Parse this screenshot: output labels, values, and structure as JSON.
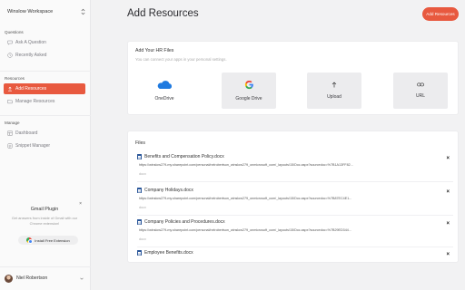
{
  "sidebar": {
    "workspace": "Winslow Workspace",
    "sections": {
      "questions": "Questions",
      "resources": "Resources",
      "manage": "Manage"
    },
    "items": {
      "ask": "Ask A Question",
      "recent": "Recently Asked",
      "add_resources": "Add Resources",
      "manage_resources": "Manage Resources",
      "dashboard": "Dashboard",
      "snippet": "Snippet Manager"
    },
    "plugin": {
      "title": "Gmail Plugin",
      "desc": "Get answers from inside of Gmail with our Chrome extension!",
      "button": "Install Free Extension",
      "close": "×"
    },
    "user": "Niel Robertson"
  },
  "header": {
    "title": "Add Resources",
    "button": "Add Resources"
  },
  "hr_files": {
    "title": "Add Your HR Files",
    "subtitle": "You can connect your apps in your personal settings.",
    "tiles": [
      {
        "label": "OneDrive",
        "icon": "onedrive-icon"
      },
      {
        "label": "Google Drive",
        "icon": "google-drive-icon"
      },
      {
        "label": "Upload",
        "icon": "upload-arrow-icon"
      },
      {
        "label": "URL",
        "icon": "link-icon"
      }
    ]
  },
  "files": {
    "title": "Files",
    "items": [
      {
        "name": "Benefits and Compensation Policy.docx",
        "url": "https://winslow279-my.sharepoint.com/personal/nelrobertson_winslow279_onmicrosoft_com/_layouts/15/Doc.aspx?sourcedoc=%7B1A13FF82...",
        "type": "docx"
      },
      {
        "name": "Company Holidays.docx",
        "url": "https://winslow279-my.sharepoint.com/personal/nelrobertson_winslow279_onmicrosoft_com/_layouts/15/Doc.aspx?sourcedoc=%7B87EC4E1...",
        "type": "docx"
      },
      {
        "name": "Company Policies and Procedures.docx",
        "url": "https://winslow279-my.sharepoint.com/personal/nelrobertson_winslow279_onmicrosoft_com/_layouts/15/Doc.aspx?sourcedoc=%7B29ED344...",
        "type": "docx"
      },
      {
        "name": "Employee Benefits.docx",
        "url": "",
        "type": ""
      }
    ],
    "remove": "×"
  },
  "colors": {
    "accent": "#e8593f",
    "background": "#f2f2f3",
    "sidebar": "#fafafa"
  }
}
